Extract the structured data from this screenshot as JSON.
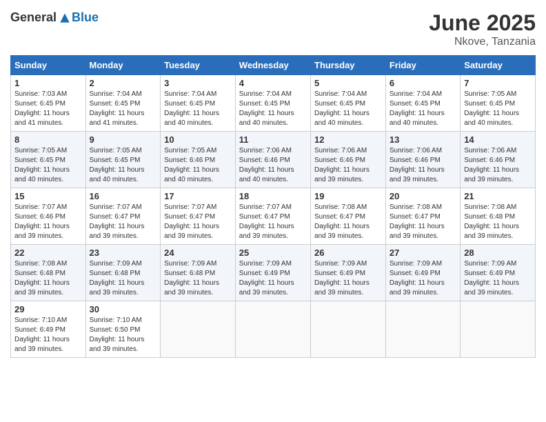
{
  "header": {
    "logo_general": "General",
    "logo_blue": "Blue",
    "month_year": "June 2025",
    "location": "Nkove, Tanzania"
  },
  "calendar": {
    "days_of_week": [
      "Sunday",
      "Monday",
      "Tuesday",
      "Wednesday",
      "Thursday",
      "Friday",
      "Saturday"
    ],
    "weeks": [
      [
        null,
        null,
        null,
        null,
        null,
        null,
        null
      ]
    ],
    "cells": [
      {
        "day": null,
        "week": 0,
        "col": 0
      },
      {
        "day": null,
        "week": 0,
        "col": 1
      },
      {
        "day": null,
        "week": 0,
        "col": 2
      },
      {
        "day": null,
        "week": 0,
        "col": 3
      },
      {
        "day": null,
        "week": 0,
        "col": 4
      },
      {
        "day": null,
        "week": 0,
        "col": 5
      },
      {
        "day": null,
        "week": 0,
        "col": 6
      }
    ],
    "rows": [
      [
        {
          "num": "1",
          "sunrise": "7:03 AM",
          "sunset": "6:45 PM",
          "daylight": "11 hours and 41 minutes."
        },
        {
          "num": "2",
          "sunrise": "7:04 AM",
          "sunset": "6:45 PM",
          "daylight": "11 hours and 41 minutes."
        },
        {
          "num": "3",
          "sunrise": "7:04 AM",
          "sunset": "6:45 PM",
          "daylight": "11 hours and 40 minutes."
        },
        {
          "num": "4",
          "sunrise": "7:04 AM",
          "sunset": "6:45 PM",
          "daylight": "11 hours and 40 minutes."
        },
        {
          "num": "5",
          "sunrise": "7:04 AM",
          "sunset": "6:45 PM",
          "daylight": "11 hours and 40 minutes."
        },
        {
          "num": "6",
          "sunrise": "7:04 AM",
          "sunset": "6:45 PM",
          "daylight": "11 hours and 40 minutes."
        },
        {
          "num": "7",
          "sunrise": "7:05 AM",
          "sunset": "6:45 PM",
          "daylight": "11 hours and 40 minutes."
        }
      ],
      [
        {
          "num": "8",
          "sunrise": "7:05 AM",
          "sunset": "6:45 PM",
          "daylight": "11 hours and 40 minutes."
        },
        {
          "num": "9",
          "sunrise": "7:05 AM",
          "sunset": "6:45 PM",
          "daylight": "11 hours and 40 minutes."
        },
        {
          "num": "10",
          "sunrise": "7:05 AM",
          "sunset": "6:46 PM",
          "daylight": "11 hours and 40 minutes."
        },
        {
          "num": "11",
          "sunrise": "7:06 AM",
          "sunset": "6:46 PM",
          "daylight": "11 hours and 40 minutes."
        },
        {
          "num": "12",
          "sunrise": "7:06 AM",
          "sunset": "6:46 PM",
          "daylight": "11 hours and 39 minutes."
        },
        {
          "num": "13",
          "sunrise": "7:06 AM",
          "sunset": "6:46 PM",
          "daylight": "11 hours and 39 minutes."
        },
        {
          "num": "14",
          "sunrise": "7:06 AM",
          "sunset": "6:46 PM",
          "daylight": "11 hours and 39 minutes."
        }
      ],
      [
        {
          "num": "15",
          "sunrise": "7:07 AM",
          "sunset": "6:46 PM",
          "daylight": "11 hours and 39 minutes."
        },
        {
          "num": "16",
          "sunrise": "7:07 AM",
          "sunset": "6:47 PM",
          "daylight": "11 hours and 39 minutes."
        },
        {
          "num": "17",
          "sunrise": "7:07 AM",
          "sunset": "6:47 PM",
          "daylight": "11 hours and 39 minutes."
        },
        {
          "num": "18",
          "sunrise": "7:07 AM",
          "sunset": "6:47 PM",
          "daylight": "11 hours and 39 minutes."
        },
        {
          "num": "19",
          "sunrise": "7:08 AM",
          "sunset": "6:47 PM",
          "daylight": "11 hours and 39 minutes."
        },
        {
          "num": "20",
          "sunrise": "7:08 AM",
          "sunset": "6:47 PM",
          "daylight": "11 hours and 39 minutes."
        },
        {
          "num": "21",
          "sunrise": "7:08 AM",
          "sunset": "6:48 PM",
          "daylight": "11 hours and 39 minutes."
        }
      ],
      [
        {
          "num": "22",
          "sunrise": "7:08 AM",
          "sunset": "6:48 PM",
          "daylight": "11 hours and 39 minutes."
        },
        {
          "num": "23",
          "sunrise": "7:09 AM",
          "sunset": "6:48 PM",
          "daylight": "11 hours and 39 minutes."
        },
        {
          "num": "24",
          "sunrise": "7:09 AM",
          "sunset": "6:48 PM",
          "daylight": "11 hours and 39 minutes."
        },
        {
          "num": "25",
          "sunrise": "7:09 AM",
          "sunset": "6:49 PM",
          "daylight": "11 hours and 39 minutes."
        },
        {
          "num": "26",
          "sunrise": "7:09 AM",
          "sunset": "6:49 PM",
          "daylight": "11 hours and 39 minutes."
        },
        {
          "num": "27",
          "sunrise": "7:09 AM",
          "sunset": "6:49 PM",
          "daylight": "11 hours and 39 minutes."
        },
        {
          "num": "28",
          "sunrise": "7:09 AM",
          "sunset": "6:49 PM",
          "daylight": "11 hours and 39 minutes."
        }
      ],
      [
        {
          "num": "29",
          "sunrise": "7:10 AM",
          "sunset": "6:49 PM",
          "daylight": "11 hours and 39 minutes."
        },
        {
          "num": "30",
          "sunrise": "7:10 AM",
          "sunset": "6:50 PM",
          "daylight": "11 hours and 39 minutes."
        },
        null,
        null,
        null,
        null,
        null
      ]
    ]
  }
}
